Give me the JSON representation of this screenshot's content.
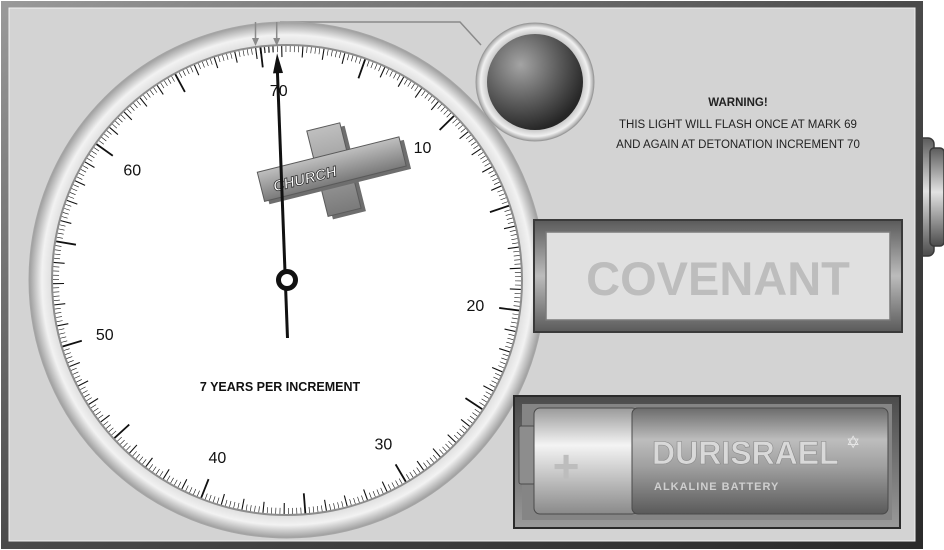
{
  "dial": {
    "marks": [
      {
        "label": "10",
        "value": 10
      },
      {
        "label": "20",
        "value": 20
      },
      {
        "label": "30",
        "value": 30
      },
      {
        "label": "40",
        "value": 40
      },
      {
        "label": "50",
        "value": 50
      },
      {
        "label": "60",
        "value": 60
      },
      {
        "label": "70",
        "value": 70
      }
    ],
    "hand_value": 70,
    "pointer_values": [
      69,
      70
    ],
    "caption": "7 YEARS PER INCREMENT",
    "church_label": "CHURCH"
  },
  "warning": {
    "title": "WARNING!",
    "line1": "THIS LIGHT WILL FLASH ONCE AT MARK 69",
    "line2": "AND AGAIN AT DETONATION INCREMENT 70"
  },
  "display": {
    "text": "COVENANT"
  },
  "battery": {
    "plus": "+",
    "brand": "DURISRAEL",
    "star": "✡",
    "subtitle": "ALKALINE BATTERY"
  },
  "colors": {
    "panel": "#d2d2d2",
    "frame": "#3c3c3c",
    "display_text": "#bdbdbd",
    "light": "#555555"
  }
}
